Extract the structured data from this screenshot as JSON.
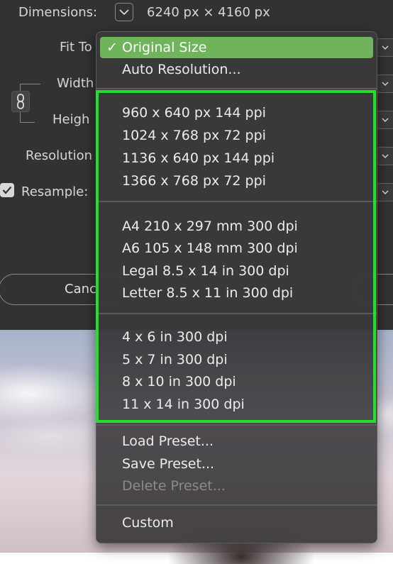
{
  "dialog": {
    "dimensions_label": "Dimensions:",
    "dimensions_value": "6240 px  ×  4160 px",
    "fit_to_label": "Fit To",
    "width_label": "Width",
    "height_label": "Heigh",
    "resolution_label": "Resolution",
    "resample_label": "Resample:",
    "resample_checked": true,
    "cancel_label": "Canc"
  },
  "menu": {
    "selected": "Original Size",
    "items_top": [
      "Original Size",
      "Auto Resolution..."
    ],
    "group_screen": [
      "960 x 640 px 144 ppi",
      "1024 x 768 px 72 ppi",
      "1136 x 640 px 144 ppi",
      "1366 x 768 px 72 ppi"
    ],
    "group_paper": [
      "A4 210 x 297 mm 300 dpi",
      "A6 105 x 148 mm 300 dpi",
      "Legal 8.5 x 14 in 300 dpi",
      "Letter 8.5 x 11 in 300 dpi"
    ],
    "group_photo": [
      "4 x 6 in 300 dpi",
      "5 x 7 in 300 dpi",
      "8 x 10 in 300 dpi",
      "11 x 14 in 300 dpi"
    ],
    "preset_items": [
      "Load Preset...",
      "Save Preset...",
      "Delete Preset..."
    ],
    "delete_preset_disabled": true,
    "custom": "Custom"
  },
  "colors": {
    "selected_bg": "#6fb45a",
    "highlight_box": "#22e12a",
    "dialog_bg": "#323232"
  },
  "icons": {
    "check": "checkmark-icon",
    "link": "chain-link-icon",
    "dropdown": "chevron-down-icon"
  }
}
